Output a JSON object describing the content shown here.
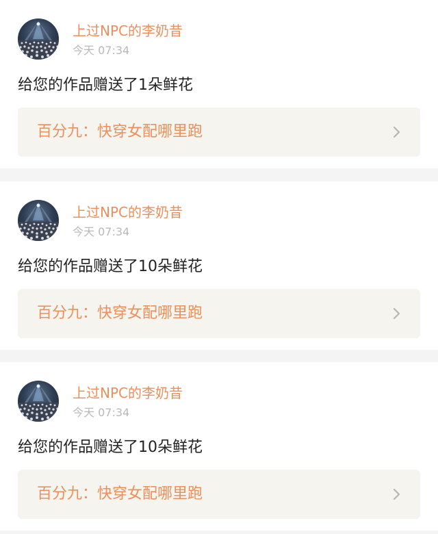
{
  "notifications": [
    {
      "username": "上过NPC的李奶昔",
      "time": "今天 07:34",
      "message": "给您的作品赠送了1朵鲜花",
      "work_title": "百分九：快穿女配哪里跑",
      "avatar_icon": "concert-crowd-avatar",
      "link_icon": "chevron-right-icon"
    },
    {
      "username": "上过NPC的李奶昔",
      "time": "今天 07:34",
      "message": "给您的作品赠送了10朵鲜花",
      "work_title": "百分九：快穿女配哪里跑",
      "avatar_icon": "concert-crowd-avatar",
      "link_icon": "chevron-right-icon"
    },
    {
      "username": "上过NPC的李奶昔",
      "time": "今天 07:34",
      "message": "给您的作品赠送了10朵鲜花",
      "work_title": "百分九：快穿女配哪里跑",
      "avatar_icon": "concert-crowd-avatar",
      "link_icon": "chevron-right-icon"
    }
  ],
  "colors": {
    "accent": "#ec8f5b",
    "timestamp": "#b9b9b9",
    "text": "#222222",
    "link_background": "#f5f4ee",
    "page_background": "#f4f4f4",
    "chevron": "#b5b5b5"
  }
}
